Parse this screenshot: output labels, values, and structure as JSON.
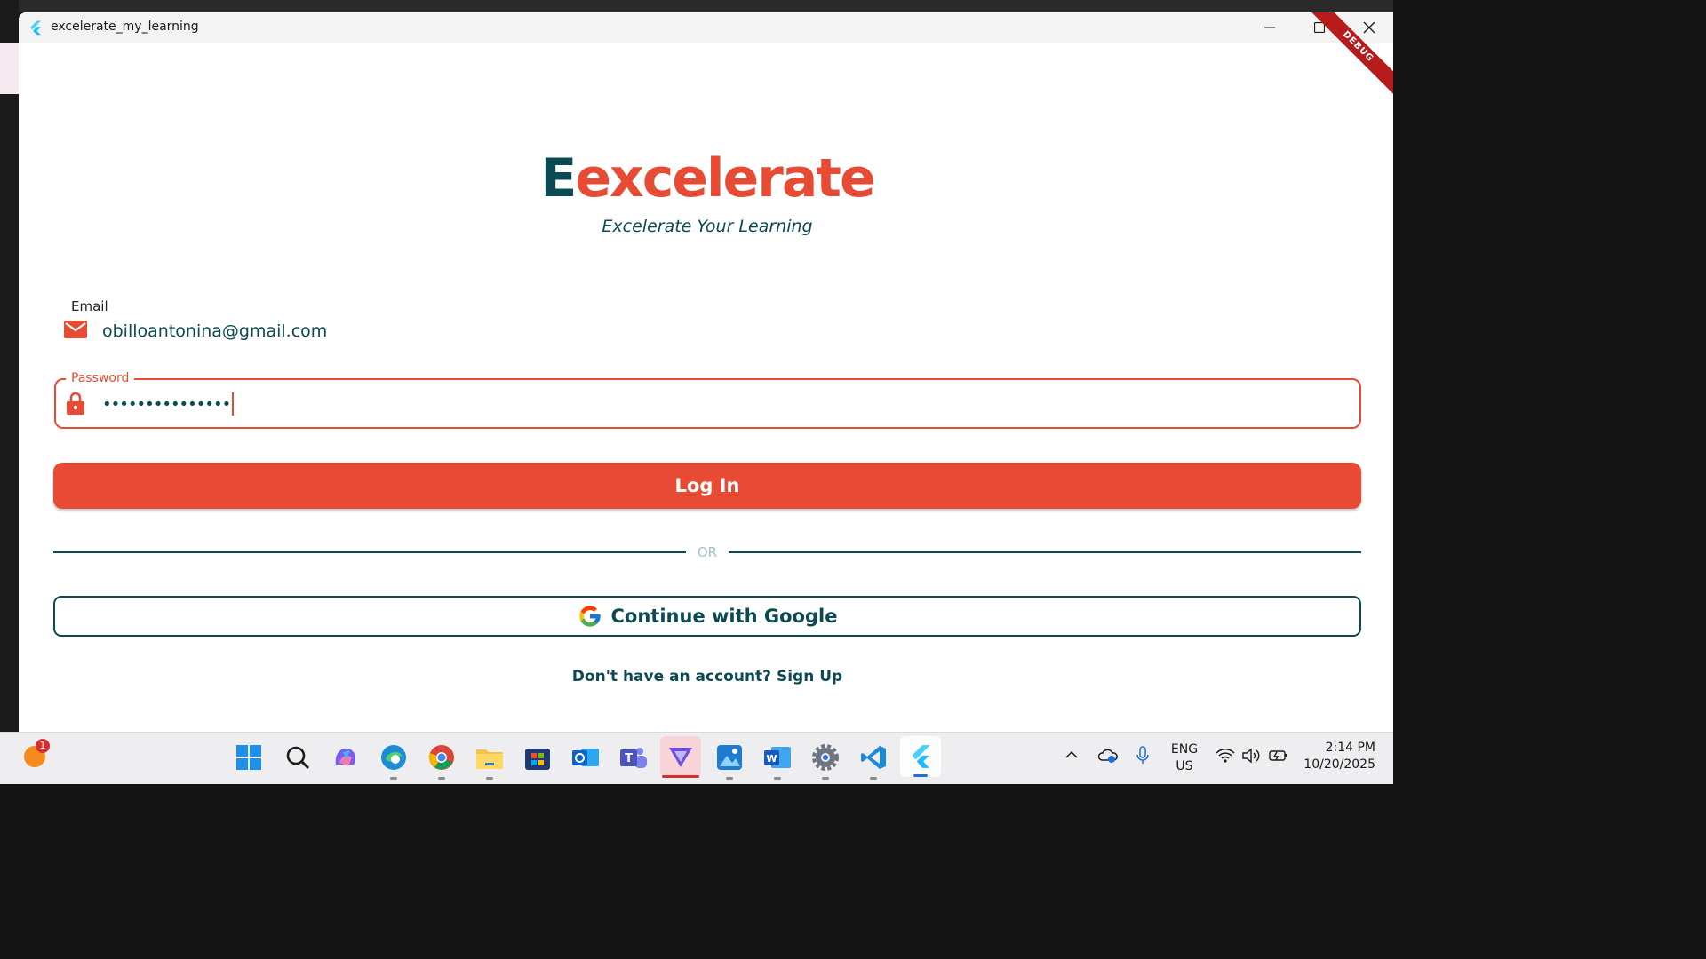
{
  "window": {
    "title": "excelerate_my_learning",
    "debug_banner": "DEBUG"
  },
  "brand": {
    "logo_first": "E",
    "logo_rest": "excelerate",
    "tagline": "Excelerate Your Learning",
    "primary_color": "#e84b34",
    "secondary_color": "#0b4a52"
  },
  "form": {
    "email_label": "Email",
    "email_value": "obilloantonina@gmail.com",
    "password_label": "Password",
    "password_value": "•••••••••••••••",
    "login_label": "Log In",
    "divider_text": "OR",
    "google_label": "Continue with Google",
    "signup_text": "Don't have an account? Sign Up"
  },
  "taskbar": {
    "notification_count": "1",
    "apps": [
      "start-icon",
      "search-icon",
      "copilot-icon",
      "edge-icon",
      "chrome-icon",
      "file-explorer-icon",
      "store-icon",
      "outlook-icon",
      "teams-icon",
      "app-icon",
      "photos-icon",
      "word-icon",
      "settings-icon",
      "vscode-icon",
      "flutter-icon"
    ],
    "lang_line1": "ENG",
    "lang_line2": "US",
    "time": "2:14 PM",
    "date": "10/20/2025"
  }
}
